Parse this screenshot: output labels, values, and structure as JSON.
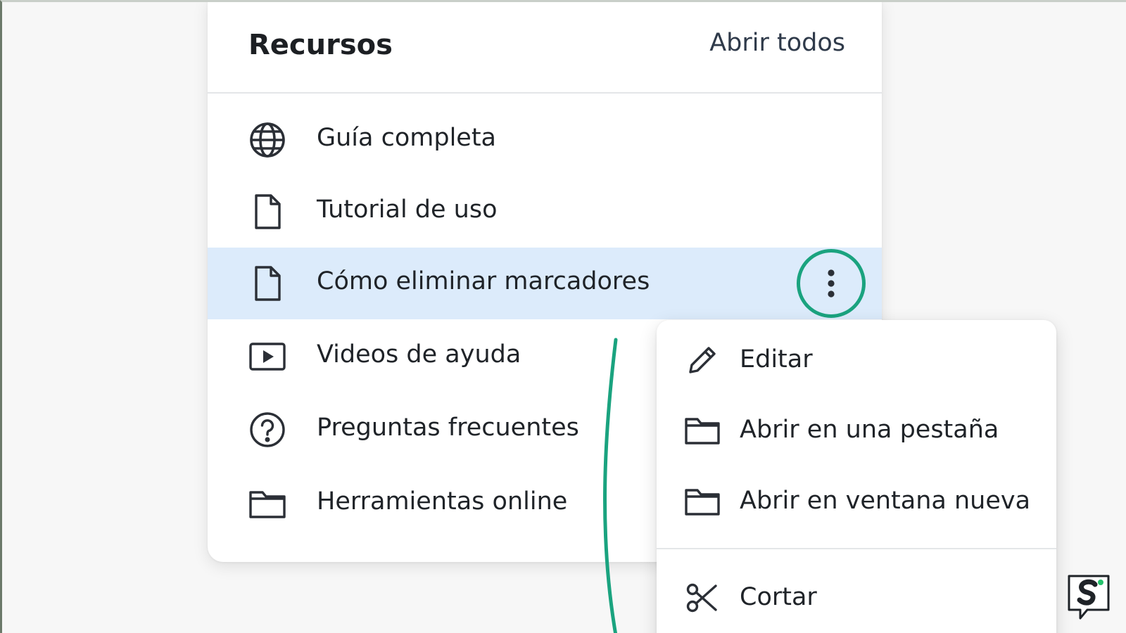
{
  "panel": {
    "title": "Recursos",
    "open_all_label": "Abrir todos"
  },
  "resources": [
    {
      "label": "Guía completa",
      "icon": "globe-icon"
    },
    {
      "label": "Tutorial de uso",
      "icon": "document-icon"
    },
    {
      "label": "Cómo eliminar marcadores",
      "icon": "document-icon",
      "selected": true
    },
    {
      "label": "Videos de ayuda",
      "icon": "video-play-icon"
    },
    {
      "label": "Preguntas frecuentes",
      "icon": "question-circle-icon"
    },
    {
      "label": "Herramientas online",
      "icon": "folder-icon"
    }
  ],
  "context_menu": {
    "items": [
      {
        "label": "Editar",
        "icon": "pencil-icon"
      },
      {
        "label": "Abrir en una pestaña",
        "icon": "folder-icon"
      },
      {
        "label": "Abrir en ventana nueva",
        "icon": "folder-icon"
      },
      {
        "label": "Cortar",
        "icon": "scissors-icon"
      }
    ]
  },
  "colors": {
    "highlight_ring": "#1aa37f",
    "selected_row": "#dcebfb",
    "logo_green": "#23c26b"
  }
}
